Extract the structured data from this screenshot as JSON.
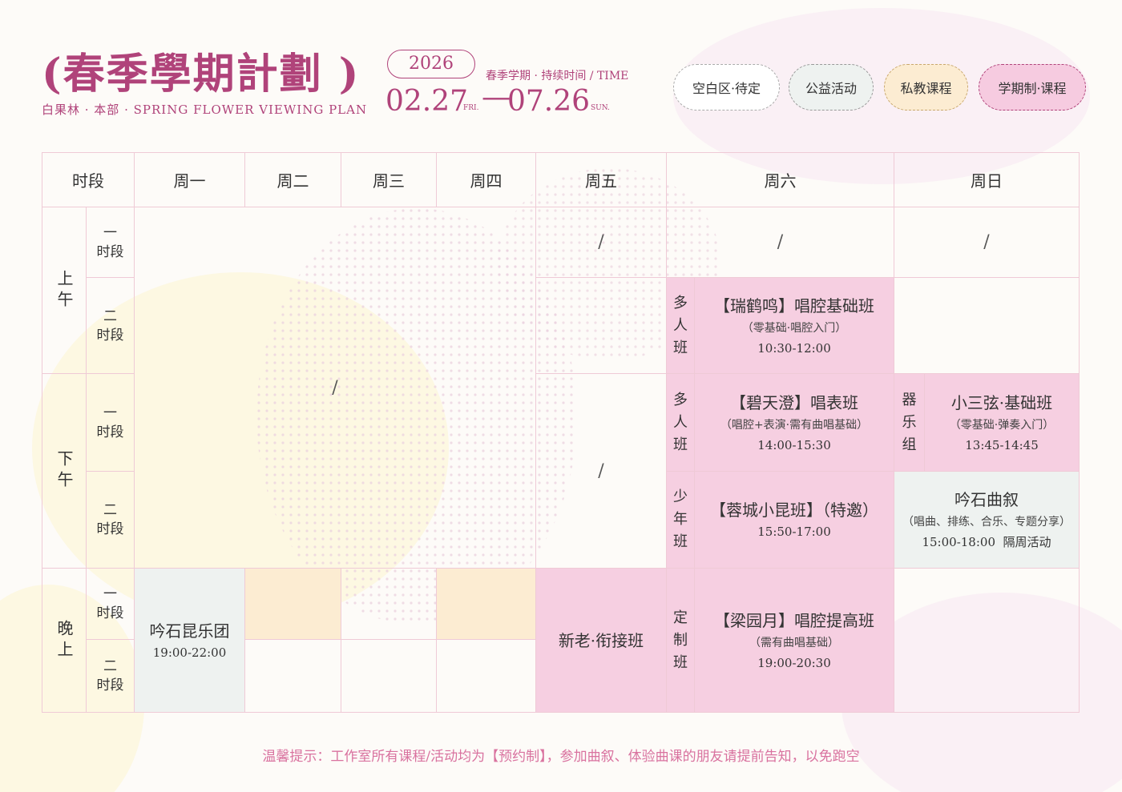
{
  "header": {
    "title": "(春季學期計劃 )",
    "subtitle": "白果林 · 本部 · SPRING FLOWER VIEWING PLAN",
    "year": "2026",
    "time_label": "春季学期 · 持续时间 / TIME",
    "start_date": "02.27",
    "start_day": "FRI.",
    "dash": "—",
    "end_date": "07.26",
    "end_day": "SUN."
  },
  "legend": {
    "blank": "空白区·待定",
    "public": "公益活动",
    "private": "私教课程",
    "term": "学期制·课程"
  },
  "colors": {
    "accent": "#b0437a",
    "term_pink": "#f6cfe1",
    "private_cream": "#fcecd2",
    "public_grey": "#eef2f0",
    "grid_line": "#efcad6"
  },
  "table": {
    "headers": {
      "period": "时段",
      "mon": "周一",
      "tue": "周二",
      "wed": "周三",
      "thu": "周四",
      "fri": "周五",
      "sat": "周六",
      "sun": "周日"
    },
    "groups": {
      "morning": "上午",
      "afternoon": "下午",
      "evening": "晚上"
    },
    "slot_first": [
      "一",
      "时段"
    ],
    "slot_second": [
      "二",
      "时段"
    ],
    "slash": "/",
    "cells": {
      "fri_evening": "新老·衔接班",
      "mon_evening_title": "吟石昆乐团",
      "mon_evening_time": "19:00-22:00",
      "sat_m2_type": [
        "多",
        "人",
        "班"
      ],
      "sat_m2_title": "【瑞鹤鸣】唱腔基础班",
      "sat_m2_note": "（零基础·唱腔入门）",
      "sat_m2_time": "10:30-12:00",
      "sat_a1_type": [
        "多",
        "人",
        "班"
      ],
      "sat_a1_title": "【碧天澄】唱表班",
      "sat_a1_note": "（唱腔+表演·需有曲唱基础）",
      "sat_a1_time": "14:00-15:30",
      "sat_a2_type": [
        "少",
        "年",
        "班"
      ],
      "sat_a2_title": "【蓉城小昆班】（特邀）",
      "sat_a2_time": "15:50-17:00",
      "sat_e_type": [
        "定",
        "制",
        "班"
      ],
      "sat_e_title": "【梁园月】唱腔提高班",
      "sat_e_note": "（需有曲唱基础）",
      "sat_e_time": "19:00-20:30",
      "sun_a1_type": [
        "器",
        "乐",
        "组"
      ],
      "sun_a1_title": "小三弦·基础班",
      "sun_a1_note": "（零基础·弹奏入门）",
      "sun_a1_time": "13:45-14:45",
      "sun_a2_title": "吟石曲叙",
      "sun_a2_note": "（唱曲、排练、合乐、专题分享）",
      "sun_a2_time": "15:00-18:00  隔周活动"
    }
  },
  "footer": "温馨提示：工作室所有课程/活动均为【预约制】，参加曲叙、体验曲课的朋友请提前告知，以免跑空"
}
